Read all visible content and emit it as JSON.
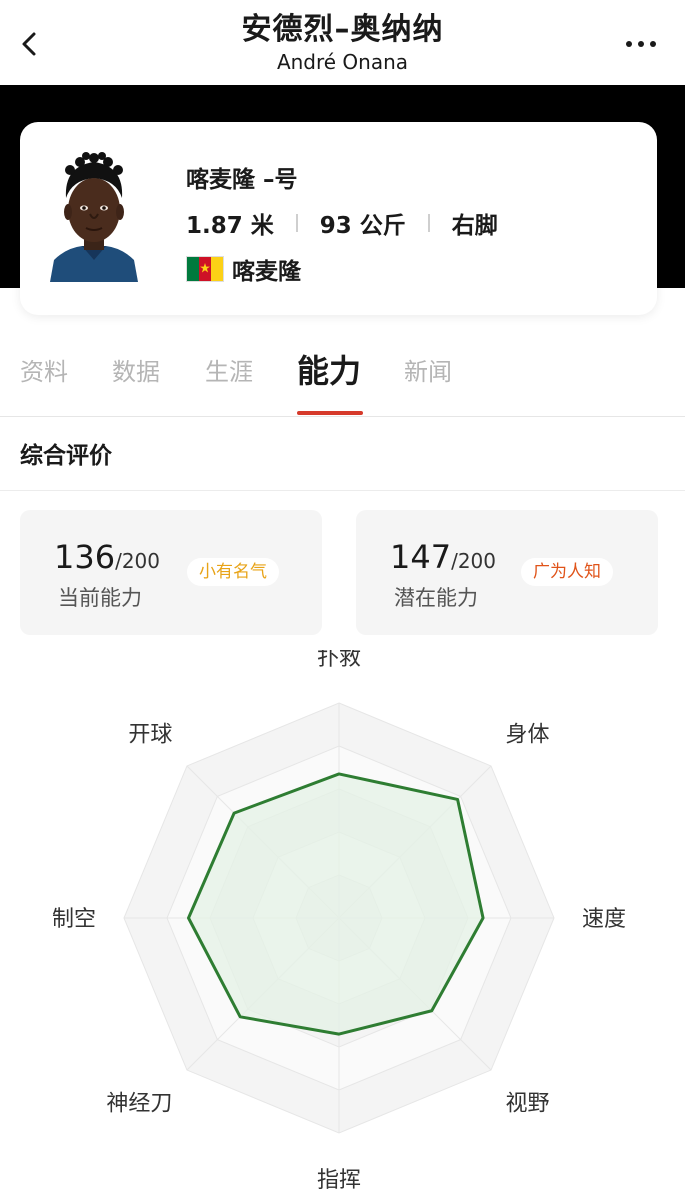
{
  "header": {
    "title_cn": "安德烈–奥纳纳",
    "title_en": "André Onana"
  },
  "profile": {
    "club": "喀麦隆 –号",
    "height": "1.87 米",
    "weight": "93 公斤",
    "foot": "右脚",
    "nationality": "喀麦隆",
    "flag_colors": [
      "#007a3d",
      "#ce1126",
      "#fcd116"
    ]
  },
  "tabs": [
    {
      "label": "资料"
    },
    {
      "label": "数据"
    },
    {
      "label": "生涯"
    },
    {
      "label": "能力",
      "active": true
    },
    {
      "label": "新闻"
    }
  ],
  "section_title": "综合评价",
  "ability": {
    "current": {
      "score": "136",
      "max": "/200",
      "label": "当前能力",
      "badge": "小有名气",
      "badge_color": "#e8a317"
    },
    "potential": {
      "score": "147",
      "max": "/200",
      "label": "潜在能力",
      "badge": "广为人知",
      "badge_color": "#e0541a"
    }
  },
  "radar": {
    "labels": [
      "扑救",
      "身体",
      "速度",
      "视野",
      "指挥",
      "神经刀",
      "制空",
      "开球"
    ],
    "values": [
      0.67,
      0.78,
      0.67,
      0.61,
      0.54,
      0.65,
      0.7,
      0.69
    ],
    "stroke_color": "#2e7d32",
    "fill_color": "#e4f1e5"
  }
}
